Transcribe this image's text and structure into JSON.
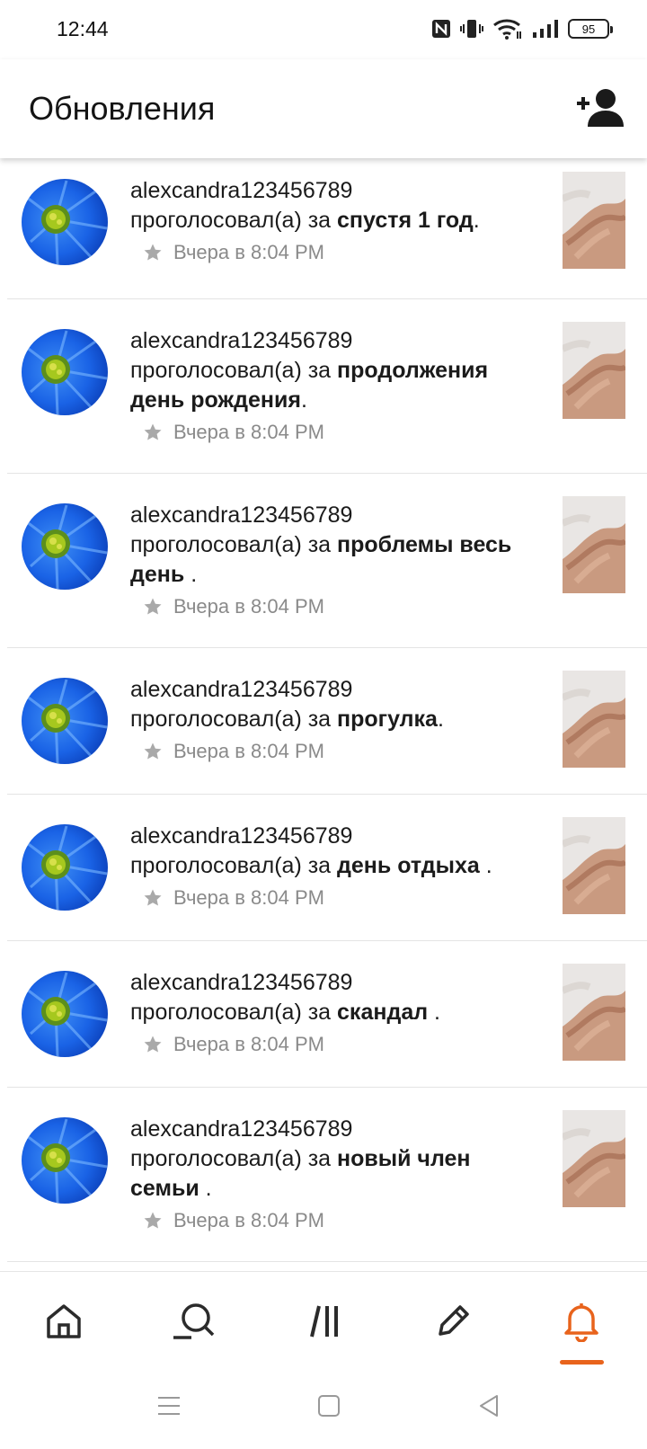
{
  "status_bar": {
    "time": "12:44",
    "battery": "95"
  },
  "header": {
    "title": "Обновления",
    "add_friend_icon": "add-person-icon"
  },
  "feed": [
    {
      "username": "alexcandra123456789",
      "action_prefix": "проголосовал(а) за ",
      "subject": "спустя 1 год",
      "suffix": ".",
      "timestamp": "Вчера в 8:04 PM"
    },
    {
      "username": "alexcandra123456789",
      "action_prefix": "проголосовал(а) за ",
      "subject": "продолжения день рождения",
      "suffix": ".",
      "timestamp": "Вчера в 8:04 PM"
    },
    {
      "username": "alexcandra123456789",
      "action_prefix": "проголосовал(а) за ",
      "subject": "проблемы весь день",
      "suffix": " .",
      "timestamp": "Вчера в 8:04 PM"
    },
    {
      "username": "alexcandra123456789",
      "action_prefix": "проголосовал(а) за ",
      "subject": "прогулка",
      "suffix": ".",
      "timestamp": "Вчера в 8:04 PM"
    },
    {
      "username": "alexcandra123456789",
      "action_prefix": "проголосовал(а) за ",
      "subject": "день отдыха",
      "suffix": " .",
      "timestamp": "Вчера в 8:04 PM"
    },
    {
      "username": "alexcandra123456789",
      "action_prefix": "проголосовал(а) за ",
      "subject": "скандал",
      "suffix": " .",
      "timestamp": "Вчера в 8:04 PM"
    },
    {
      "username": "alexcandra123456789",
      "action_prefix": "проголосовал(а) за ",
      "subject": "новый член семьи",
      "suffix": " .",
      "timestamp": "Вчера в 8:04 PM"
    }
  ],
  "bottom_nav": [
    {
      "icon": "home-icon",
      "active": false
    },
    {
      "icon": "search-icon",
      "active": false
    },
    {
      "icon": "library-icon",
      "active": false
    },
    {
      "icon": "pencil-icon",
      "active": false
    },
    {
      "icon": "bell-icon",
      "active": true
    }
  ],
  "colors": {
    "accent": "#e8631c",
    "icon": "#2b2b2b",
    "muted": "#8a8a8a"
  }
}
